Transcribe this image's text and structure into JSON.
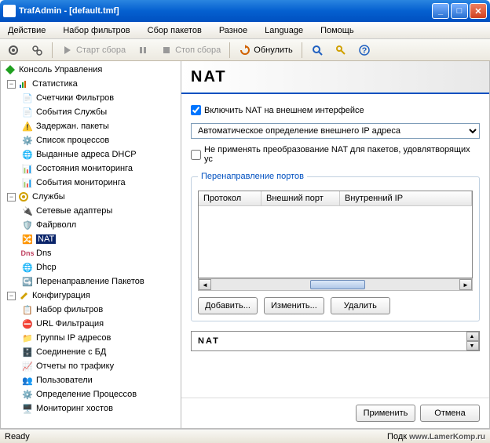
{
  "window": {
    "title": "TrafAdmin - [default.tmf]"
  },
  "menu": [
    "Действие",
    "Набор фильтров",
    "Сбор пакетов",
    "Разное",
    "Language",
    "Помощь"
  ],
  "toolbar": {
    "start": "Старт сбора",
    "stop": "Стоп сбора",
    "reset": "Обнулить"
  },
  "tree": {
    "root": "Консоль Управления",
    "stats": "Статистика",
    "stats_children": [
      "Счетчики Фильтров",
      "События Службы",
      "Задержан. пакеты",
      "Список процессов",
      "Выданные адреса DHCP",
      "Состояния мониторинга",
      "События мониторинга"
    ],
    "services": "Службы",
    "services_children": [
      "Сетевые адаптеры",
      "Файрволл",
      "NAT",
      "Dns",
      "Dhcp",
      "Перенаправление Пакетов"
    ],
    "config": "Конфигурация",
    "config_children": [
      "Набор фильтров",
      "URL Фильтрация",
      "Группы IP адресов",
      "Соединение с БД",
      "Отчеты по трафику",
      "Пользователи",
      "Определение Процессов",
      "Мониторинг хостов"
    ]
  },
  "main": {
    "title": "NAT",
    "enable_checkbox": "Включить NAT на внешнем интерфейсе",
    "enable_checked": true,
    "select_value": "Автоматическое определение внешнего IP адреса",
    "no_transform_checkbox": "Не применять преобразование NAT для пакетов, удовлятворящих ус",
    "no_transform_checked": false,
    "fieldset_legend": "Перенаправление портов",
    "columns": [
      "Протокол",
      "Внешний порт",
      "Внутренний IP"
    ],
    "add_btn": "Добавить...",
    "edit_btn": "Изменить...",
    "delete_btn": "Удалить",
    "lower_label": "NAT",
    "apply": "Применить",
    "cancel": "Отмена"
  },
  "status": {
    "left": "Ready",
    "right_prefix": "Подк",
    "watermark": "www.LamerKomp.ru"
  }
}
